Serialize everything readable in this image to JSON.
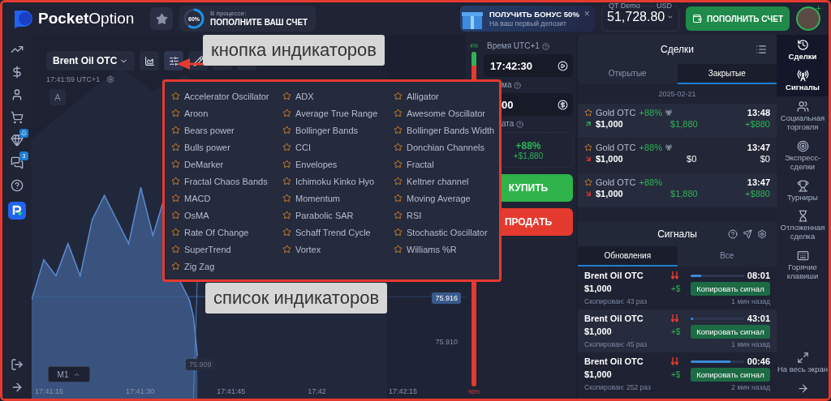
{
  "header": {
    "logo": "**Pocket**Option",
    "progress": {
      "level": 0.6,
      "label": "60%",
      "status": "В процессе:",
      "title": "ПОПОЛНИТЕ ВАШ СЧЕТ"
    },
    "bonus": {
      "title": "ПОЛУЧИТЬ БОНУС 50%",
      "subtitle": "На ваш первый депозит",
      "close": "×"
    },
    "account": {
      "type": "QT Demo",
      "currency": "USD",
      "balance": "51,728.80"
    },
    "deposit_button": "ПОПОЛНИТЬ СЧЕТ"
  },
  "left_sidebar": {
    "items": [
      {
        "kind": "chart"
      },
      {
        "kind": "dollar"
      },
      {
        "kind": "user"
      },
      {
        "kind": "cart"
      },
      {
        "kind": "gem",
        "alert": true
      },
      {
        "kind": "chat",
        "badge": "3"
      },
      {
        "kind": "help"
      },
      {
        "kind": "app"
      }
    ],
    "bottom": [
      {
        "kind": "logout"
      },
      {
        "kind": "arrow"
      }
    ]
  },
  "chart": {
    "asset": "Brent Oil OTC",
    "clock": "17:41:59 UTC+1",
    "mode_button": "A",
    "timeframe": "M1",
    "price_labels": [
      {
        "kind": "tag",
        "text": "75.916"
      },
      {
        "kind": "plain",
        "text": "75.910"
      },
      {
        "kind": "faded",
        "text": "75.909"
      }
    ],
    "time_axis": [
      "17:41:15",
      "17:41:30",
      "17:41:45",
      "17:42",
      "17:42:15"
    ]
  },
  "sentiment": {
    "up": "4%",
    "down": "96%",
    "level": 0.04
  },
  "trade": {
    "time_label": "Время UTC+1",
    "time": "17:42:30",
    "amount_label": "ма",
    "amount": "00",
    "payout_label": "ата",
    "payout_percent": "+88%",
    "payout_amount": "+$1,880",
    "buy": "КУПИТЬ",
    "sell": "ПРОДАТЬ"
  },
  "deals": {
    "title": "Сделки",
    "tabs": [
      {
        "label": "Открытые",
        "selected": false
      },
      {
        "label": "Закрытые",
        "selected": true
      }
    ],
    "date": "2025-02-21",
    "items": [
      {
        "asset": "Gold OTC",
        "percent": "+88%",
        "signal": true,
        "time": "13:48",
        "kind": "up",
        "amount": "$1,000",
        "payout": "$1,880",
        "profit": "+$880",
        "won": true
      },
      {
        "asset": "Gold OTC",
        "percent": "+88%",
        "signal": true,
        "time": "13:47",
        "kind": "down",
        "amount": "$1,000",
        "payout": "$0",
        "profit": "$0",
        "won": false
      },
      {
        "asset": "Gold OTC",
        "percent": "+88%",
        "signal": false,
        "time": "13:47",
        "kind": "down",
        "amount": "$1,000",
        "payout": "$1,880",
        "profit": "+$880",
        "won": true
      }
    ]
  },
  "signals": {
    "title": "Сигналы",
    "tabs": [
      {
        "label": "Обновления",
        "selected": true
      },
      {
        "label": "Все",
        "selected": false
      }
    ],
    "items": [
      {
        "asset": "Brent Oil OTC",
        "amount": "$1,000",
        "copied": "Скопирован: 43 раз",
        "plus": "+$",
        "level": 0.2,
        "time": "08:01",
        "button": "Копировать сигнал",
        "ago": "1 мин назад"
      },
      {
        "asset": "Brent Oil OTC",
        "amount": "$1,000",
        "copied": "Скопирован: 45 раз",
        "plus": "+$",
        "level": 0.05,
        "time": "43:01",
        "button": "Копировать сигнал",
        "ago": "1 мин назад"
      },
      {
        "asset": "Brent Oil OTC",
        "amount": "$1,000",
        "copied": "Скопирован: 252 раз",
        "plus": "+$",
        "level": 0.75,
        "time": "00:46",
        "button": "Копировать сигнал",
        "ago": "2 мин назад"
      }
    ]
  },
  "right_sidebar": {
    "items": [
      {
        "kind": "history",
        "label": "Сделки",
        "selected": true
      },
      {
        "kind": "signals",
        "label": "Сигналы",
        "selected": true
      },
      {
        "kind": "social",
        "label": "Социальная торговля",
        "selected": false
      },
      {
        "kind": "express",
        "label": "Экспресс-сделки",
        "selected": false
      },
      {
        "kind": "tournaments",
        "label": "Турниры",
        "selected": false
      },
      {
        "kind": "pending",
        "label": "Отложенная сделка",
        "selected": false
      },
      {
        "kind": "hotkeys",
        "label": "Горячие клавиши",
        "selected": false
      },
      {
        "kind": "fullscreen",
        "label": "На весь экран",
        "selected": false
      },
      {
        "kind": "arrow",
        "selected": false
      }
    ]
  },
  "indicators": [
    "Accelerator Oscillator",
    "ADX",
    "Alligator",
    "Aroon",
    "Average True Range",
    "Awesome Oscillator",
    "Bears power",
    "Bollinger Bands",
    "Bollinger Bands Width",
    "Bulls power",
    "CCI",
    "Donchian Channels",
    "DeMarker",
    "Envelopes",
    "Fractal",
    "Fractal Chaos Bands",
    "Ichimoku Kinko Hyo",
    "Keltner channel",
    "MACD",
    "Momentum",
    "Moving Average",
    "OsMA",
    "Parabolic SAR",
    "RSI",
    "Rate Of Change",
    "Schaff Trend Cycle",
    "Stochastic Oscillator",
    "SuperTrend",
    "Vortex",
    "Williams %R",
    "Zig Zag"
  ],
  "annotations": {
    "button_callout": "кнопка индикаторов",
    "list_callout": "список индикаторов"
  }
}
